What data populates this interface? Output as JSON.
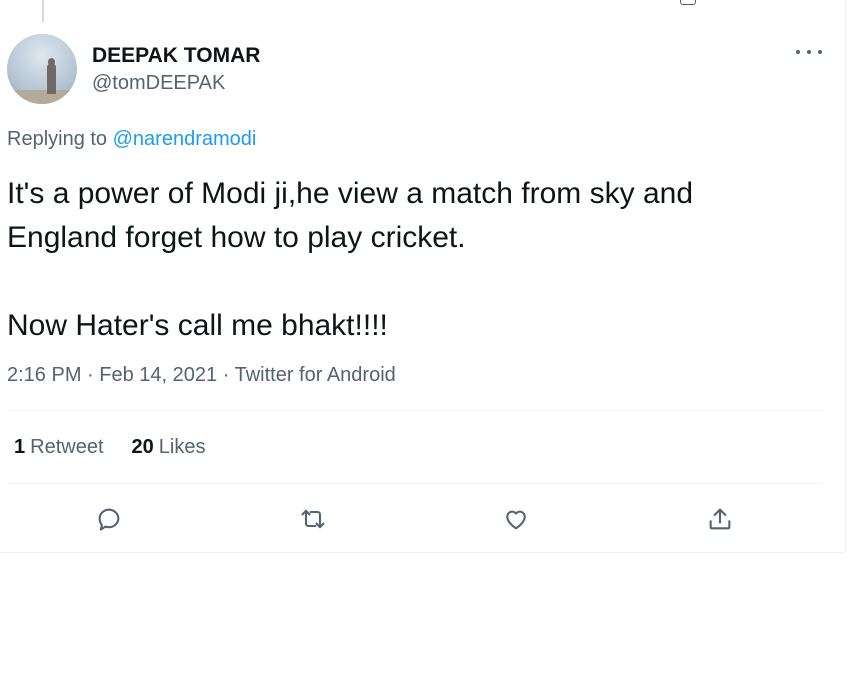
{
  "tweet": {
    "author": {
      "display_name": "DEEPAK TOMAR",
      "handle": "@tomDEEPAK"
    },
    "replying_prefix": "Replying to",
    "replying_to": "@narendramodi",
    "text": "It's a power of Modi ji,he view a match from sky and\nEngland forget how to play cricket.\n\nNow Hater's call me bhakt!!!!",
    "time": "2:16 PM",
    "date": "Feb 14, 2021",
    "source": "Twitter for Android",
    "separator": "·",
    "stats": {
      "retweets_count": "1",
      "retweets_label": "Retweet",
      "likes_count": "20",
      "likes_label": "Likes"
    },
    "actions": [
      "reply-icon",
      "retweet-icon",
      "like-icon",
      "share-icon"
    ]
  },
  "colors": {
    "text_primary": "#0f1419",
    "text_secondary": "#536471",
    "link": "#1d9bf0",
    "divider": "#eff3f4"
  }
}
